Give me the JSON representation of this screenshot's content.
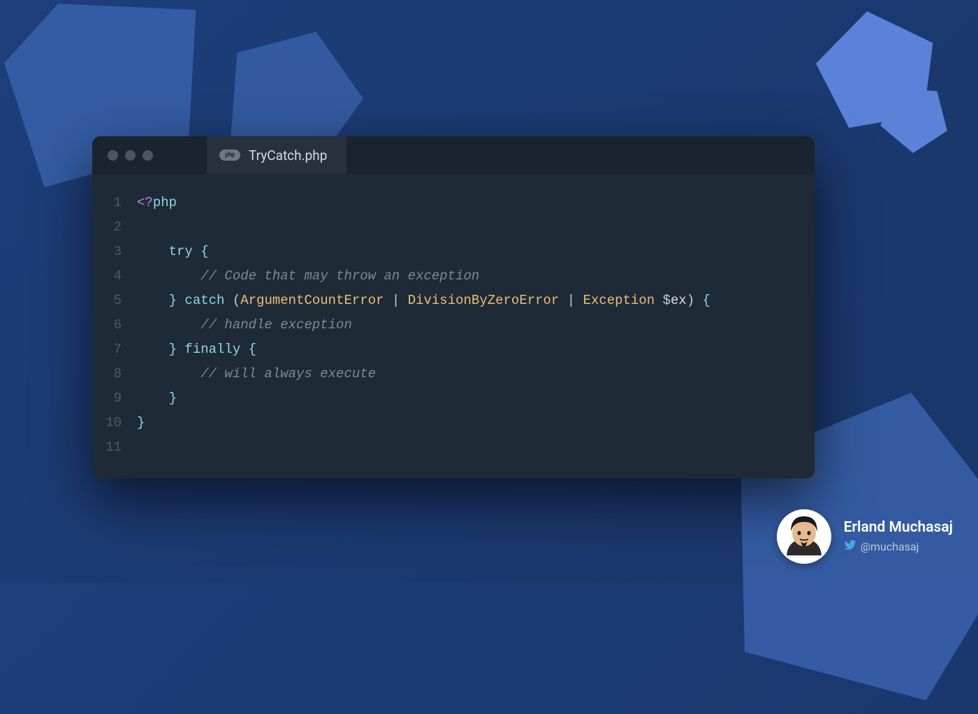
{
  "tab": {
    "icon_label": "php",
    "title": "TryCatch.php"
  },
  "gutter": {
    "lines": [
      "1",
      "2",
      "3",
      "4",
      "5",
      "6",
      "7",
      "8",
      "9",
      "10",
      "11"
    ]
  },
  "code": {
    "l1_open": "<?",
    "l1_php": "php",
    "l3_indent": "    ",
    "l3_try": "try",
    "l3_brace": " {",
    "l4_indent": "        ",
    "l4_comment": "// Code that may throw an exception",
    "l5_indent": "    ",
    "l5_close": "}",
    "l5_catch": " catch ",
    "l5_paren_open": "(",
    "l5_class1": "ArgumentCountError",
    "l5_pipe1": " | ",
    "l5_class2": "DivisionByZeroError",
    "l5_pipe2": " | ",
    "l5_class3": "Exception",
    "l5_space": " ",
    "l5_dollar": "$",
    "l5_var": "ex",
    "l5_paren_close": ")",
    "l5_brace": " {",
    "l6_indent": "        ",
    "l6_comment": "// handle exception",
    "l7_indent": "    ",
    "l7_close": "}",
    "l7_finally": " finally ",
    "l7_brace": "{",
    "l8_indent": "        ",
    "l8_comment": "// will always execute",
    "l9_indent": "    ",
    "l9_close": "}",
    "l10_close": "}"
  },
  "author": {
    "name": "Erland Muchasaj",
    "handle": "@muchasaj"
  }
}
